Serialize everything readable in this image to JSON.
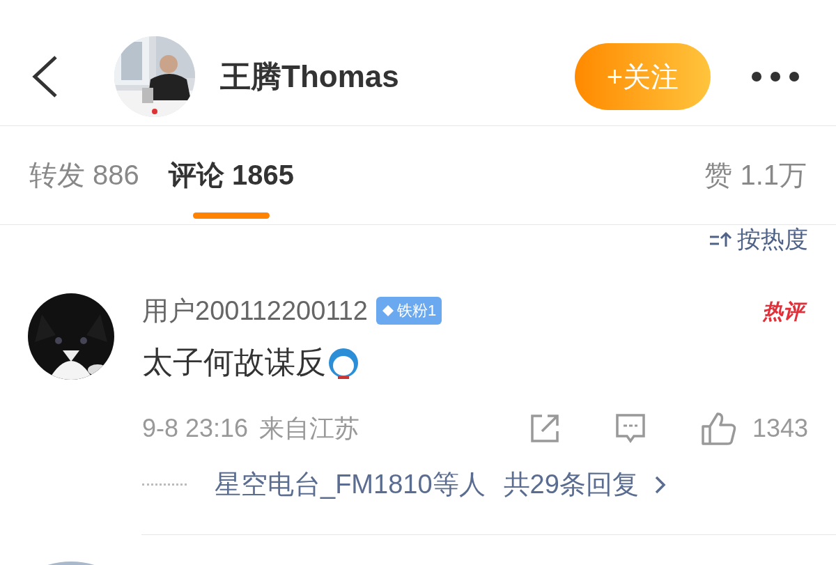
{
  "header": {
    "user_name": "王腾Thomas",
    "follow_button": "+关注"
  },
  "tabs": [
    {
      "label": "转发 886",
      "selected": false
    },
    {
      "label": "评论 1865",
      "selected": true
    }
  ],
  "likes_label": "赞 1.1万",
  "sort": {
    "label": "按热度"
  },
  "comments": [
    {
      "user": "用户200112200112",
      "badge": "铁粉1",
      "hot_label": "热评",
      "text": "太子何故谋反",
      "time": "9-8 23:16",
      "location": "来自江苏",
      "like_count": "1343",
      "replies": {
        "users": "星空电台_FM1810等人",
        "total": "共29条回复"
      }
    }
  ]
}
